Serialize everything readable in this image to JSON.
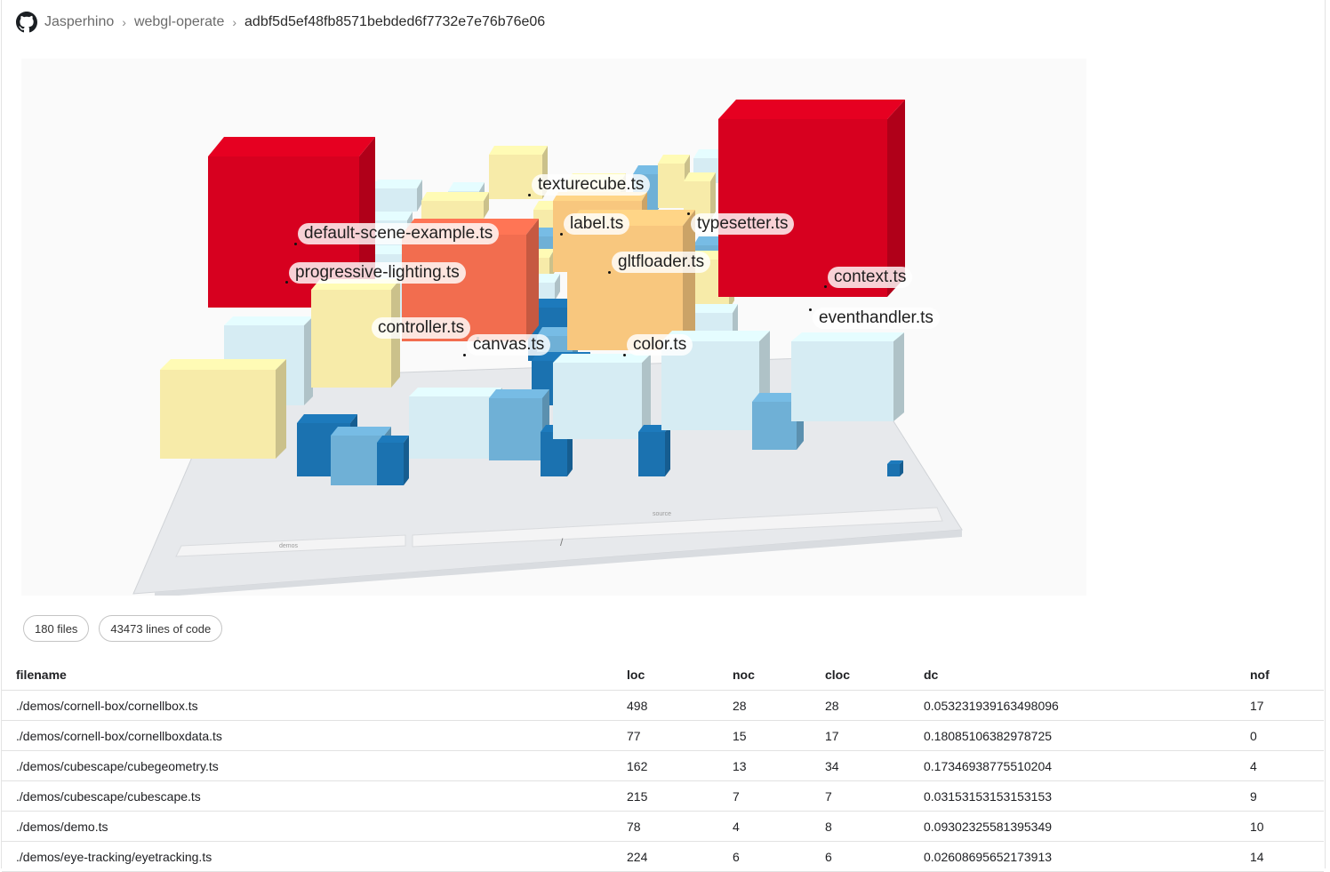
{
  "breadcrumb": {
    "owner": "Jasperhino",
    "repo": "webgl-operate",
    "commit": "adbf5d5ef48fb8571bebded6f7732e7e76b76e06",
    "separator": "›"
  },
  "visualization": {
    "labels": [
      "texturecube.ts",
      "label.ts",
      "typesetter.ts",
      "default-scene-example.ts",
      "gltfloader.ts",
      "progressive-lighting.ts",
      "context.ts",
      "eventhandler.ts",
      "controller.ts",
      "canvas.ts",
      "color.ts"
    ],
    "ground_labels": [
      "demos",
      "source",
      "/"
    ],
    "colors": {
      "red": "#d7001f",
      "orange": "#f26d4f",
      "light_orange": "#f8c77e",
      "pale_yellow": "#f7eba9",
      "pale_blue": "#d6ecf3",
      "mid_blue": "#6fb0d6",
      "dark_blue": "#1b72b0"
    }
  },
  "stats": {
    "files": "180 files",
    "lines": "43473 lines of code"
  },
  "table": {
    "columns": [
      "filename",
      "loc",
      "noc",
      "cloc",
      "dc",
      "nof"
    ],
    "rows": [
      [
        "./demos/cornell-box/cornellbox.ts",
        "498",
        "28",
        "28",
        "0.053231939163498096",
        "17"
      ],
      [
        "./demos/cornell-box/cornellboxdata.ts",
        "77",
        "15",
        "17",
        "0.18085106382978725",
        "0"
      ],
      [
        "./demos/cubescape/cubegeometry.ts",
        "162",
        "13",
        "34",
        "0.17346938775510204",
        "4"
      ],
      [
        "./demos/cubescape/cubescape.ts",
        "215",
        "7",
        "7",
        "0.03153153153153153",
        "9"
      ],
      [
        "./demos/demo.ts",
        "78",
        "4",
        "8",
        "0.09302325581395349",
        "10"
      ],
      [
        "./demos/eye-tracking/eyetracking.ts",
        "224",
        "6",
        "6",
        "0.02608695652173913",
        "14"
      ]
    ]
  }
}
